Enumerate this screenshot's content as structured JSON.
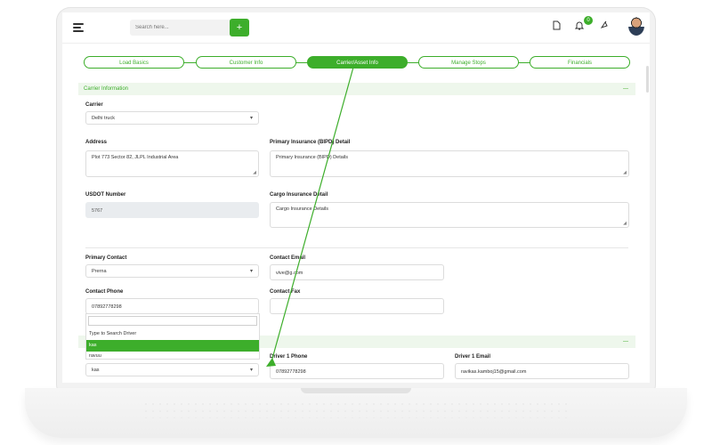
{
  "header": {
    "search_placeholder": "Search here...",
    "add_button": "+",
    "notification_count": "0",
    "icons": [
      "menu-icon",
      "search-icon",
      "document-icon",
      "bell-icon",
      "theme-icon",
      "user-avatar"
    ]
  },
  "steps": [
    {
      "label": "Load Basics",
      "active": false
    },
    {
      "label": "Customer Info",
      "active": false
    },
    {
      "label": "Carrier/Asset Info",
      "active": true
    },
    {
      "label": "Manage Stops",
      "active": false
    },
    {
      "label": "Financials",
      "active": false
    }
  ],
  "carrier_section": {
    "title": "Carrier Information",
    "toggle": "—",
    "carrier_label": "Carrier",
    "carrier_value": "Delhi truck",
    "address_label": "Address",
    "address_value": "Plot 773 Sector 82, JLPL Industrial Area",
    "insurance_label": "Primary Insurance (BIPD) Detail",
    "insurance_value": "Primary Insurance (BIPD) Details",
    "usdot_label": "USDOT Number",
    "usdot_value": "5767",
    "cargo_label": "Cargo Insurance Detail",
    "cargo_value": "Cargo Insurance Details",
    "primary_contact_label": "Primary Contact",
    "primary_contact_value": "Prerna",
    "contact_email_label": "Contact Email",
    "contact_email_value": "vive@g.com",
    "contact_phone_label": "Contact Phone",
    "contact_phone_value": "07892778298",
    "contact_fax_label": "Contact Fax",
    "contact_fax_value": ""
  },
  "driver_section": {
    "toggle": "—",
    "driver_value": "kas",
    "driver_phone_label": "Driver 1 Phone",
    "driver_phone_value": "07892778298",
    "driver_email_label": "Driver 1 Email",
    "driver_email_value": "ravikas.kamboj15@gmail.com"
  },
  "dropdown": {
    "options": [
      "Type to Search Driver",
      "kas",
      "ravuu"
    ],
    "selected": "kas"
  },
  "colors": {
    "accent": "#3dae2b",
    "section_bg": "#eef7ec"
  }
}
